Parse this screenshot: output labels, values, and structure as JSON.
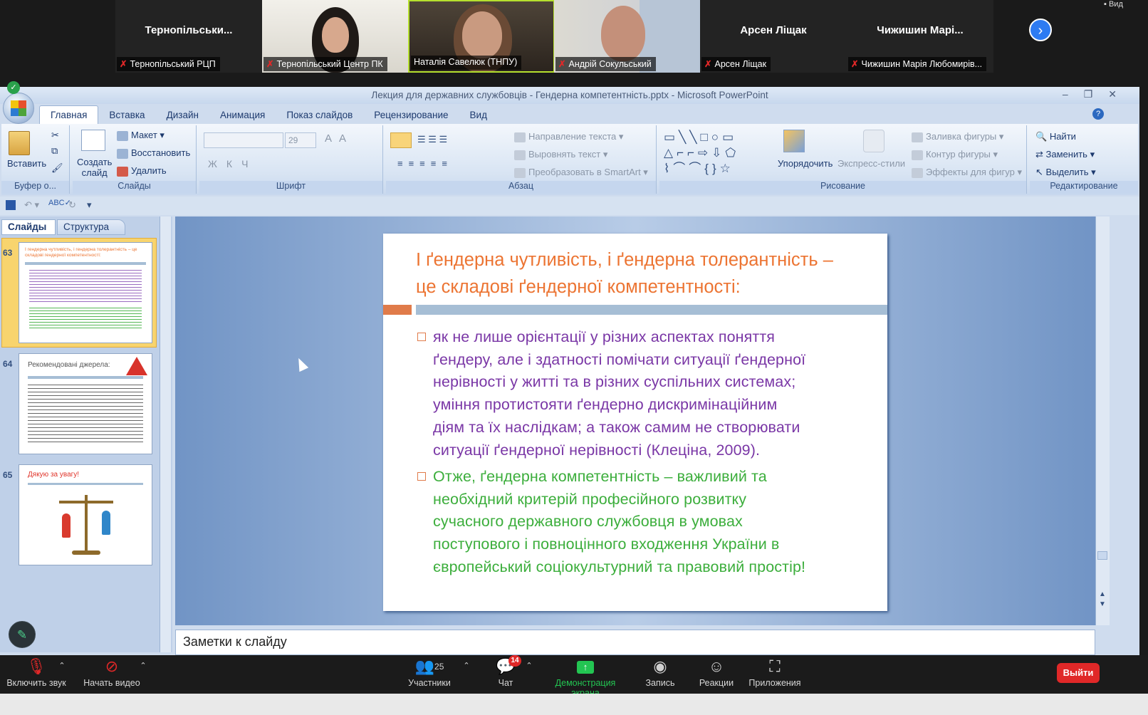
{
  "zoom": {
    "participants": [
      {
        "big_name": "Тернопільськи...",
        "caption": "Тернопільський РЦП",
        "video": false
      },
      {
        "big_name": "",
        "caption": "Тернопільський Центр ПК",
        "video": true
      },
      {
        "big_name": "",
        "caption": "Наталія Савелюк (ТНПУ)",
        "video": true,
        "active": true
      },
      {
        "big_name": "",
        "caption": "Андрій Сокульський",
        "video": true
      },
      {
        "big_name": "Арсен Ліщак",
        "caption": "Арсен Ліщак",
        "video": false
      },
      {
        "big_name": "Чижишин Марі...",
        "caption": "Чижишин Марія Любомирів...",
        "video": false
      }
    ],
    "view_label": "Вид",
    "toolbar": {
      "unmute": "Включить звук",
      "start_video": "Начать видео",
      "participants": "Участники",
      "participants_count": "25",
      "chat": "Чат",
      "chat_badge": "14",
      "share": "Демонстрация экрана",
      "record": "Запись",
      "reactions": "Реакции",
      "apps": "Приложения",
      "end": "Выйти"
    },
    "accent": "#2d7bf2",
    "share_color": "#23c552",
    "end_color": "#e02828"
  },
  "ppt": {
    "title": "Лекция для державних службовців - Гендерна компетентність.pptx - Microsoft PowerPoint",
    "tabs": [
      "Главная",
      "Вставка",
      "Дизайн",
      "Анимация",
      "Показ слайдов",
      "Рецензирование",
      "Вид"
    ],
    "ribbon": {
      "clipboard": {
        "label": "Буфер о...",
        "paste": "Вставить"
      },
      "slides": {
        "label": "Слайды",
        "new_slide_line1": "Создать",
        "new_slide_line2": "слайд",
        "layout": "Макет",
        "reset": "Восстановить",
        "delete": "Удалить"
      },
      "font": {
        "label": "Шрифт",
        "size": "29"
      },
      "paragraph": {
        "label": "Абзац",
        "text_direction": "Направление текста",
        "align_text": "Выровнять текст",
        "smartart": "Преобразовать в SmartArt"
      },
      "drawing": {
        "label": "Рисование",
        "arrange": "Упорядочить",
        "quick_styles": "Экспресс-стили",
        "shape_fill": "Заливка фигуры",
        "shape_outline": "Контур фигуры",
        "shape_effects": "Эффекты для фигур"
      },
      "editing": {
        "label": "Редактирование",
        "find": "Найти",
        "replace": "Заменить",
        "select": "Выделить"
      }
    },
    "pane_tabs": {
      "slides": "Слайды",
      "outline": "Структура"
    },
    "thumbs": [
      {
        "num": "63",
        "title": "І гендерна чутливість, і гендерна толерантність – це складові гендерної компетентності:"
      },
      {
        "num": "64",
        "title": "Рекомендовані джерела:"
      },
      {
        "num": "65",
        "title": "Дякую за увагу!"
      }
    ],
    "notes_placeholder": "Заметки к слайду",
    "slide": {
      "title_line1": "І ґендерна чутливість, і ґендерна толерантність –",
      "title_line2": "це складові ґендерної компетентності:",
      "bullet1": [
        "як не лише орієнтації у різних аспектах поняття",
        "ґендеру, але і здатності помічати ситуації ґендерної",
        "нерівності у житті та в різних суспільних системах;",
        "уміння протистояти ґендерно дискримінаційним",
        "діям та їх наслідкам; а також самим не створювати",
        "ситуації ґендерної нерівності (Клеціна, 2009)."
      ],
      "bullet2": [
        "Отже, ґендерна компетентність – важливий та",
        "необхідний критерій професійного розвитку",
        "сучасного державного службовця в умовах",
        "поступового і повноцінного входження України в",
        "європейський соціокультурний та правовий простір!"
      ],
      "title_color": "#ec7432",
      "bullet1_color": "#7a37a6",
      "bullet2_color": "#3cae3c"
    }
  }
}
